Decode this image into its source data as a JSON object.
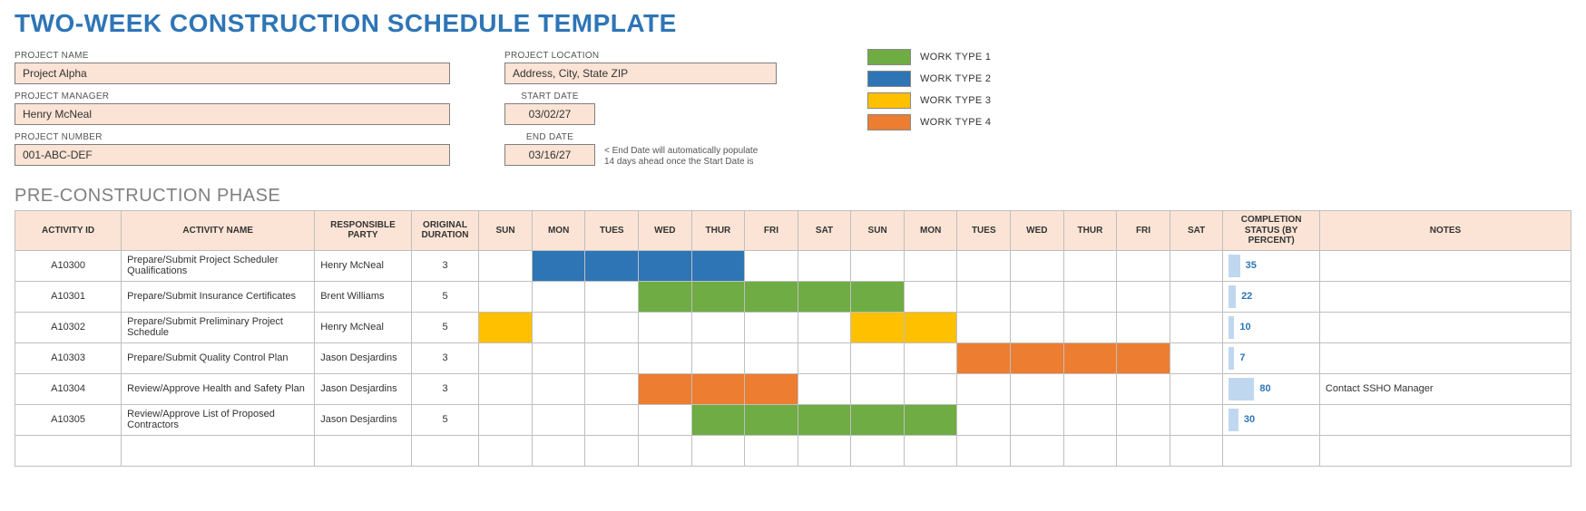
{
  "title": "TWO-WEEK CONSTRUCTION SCHEDULE TEMPLATE",
  "fields": {
    "project_name_label": "PROJECT NAME",
    "project_name": "Project Alpha",
    "project_manager_label": "PROJECT MANAGER",
    "project_manager": "Henry McNeal",
    "project_number_label": "PROJECT NUMBER",
    "project_number": "001-ABC-DEF",
    "project_location_label": "PROJECT LOCATION",
    "project_location": "Address, City, State ZIP",
    "start_date_label": "START DATE",
    "start_date": "03/02/27",
    "end_date_label": "END DATE",
    "end_date": "03/16/27",
    "end_date_note": "< End Date will automatically populate 14 days ahead once the Start Date is"
  },
  "legend": [
    {
      "color": "sw-green",
      "label": "WORK TYPE 1"
    },
    {
      "color": "sw-blue",
      "label": "WORK TYPE 2"
    },
    {
      "color": "sw-yellow",
      "label": "WORK TYPE 3"
    },
    {
      "color": "sw-orange",
      "label": "WORK TYPE 4"
    }
  ],
  "phase_title": "PRE-CONSTRUCTION PHASE",
  "columns": {
    "activity_id": "ACTIVITY ID",
    "activity_name": "ACTIVITY NAME",
    "responsible": "RESPONSIBLE PARTY",
    "duration": "ORIGINAL DURATION",
    "days": [
      "SUN",
      "MON",
      "TUES",
      "WED",
      "THUR",
      "FRI",
      "SAT",
      "SUN",
      "MON",
      "TUES",
      "WED",
      "THUR",
      "FRI",
      "SAT"
    ],
    "completion": "COMPLETION STATUS (BY PERCENT)",
    "notes": "NOTES"
  },
  "colors": {
    "blue": "#2e75b6",
    "green": "#6fac44",
    "yellow": "#ffc000",
    "orange": "#ed7d31"
  },
  "rows": [
    {
      "id": "A10300",
      "name": "Prepare/Submit Project Scheduler Qualifications",
      "resp": "Henry McNeal",
      "dur": "3",
      "bars": [
        {
          "start": 1,
          "end": 4,
          "color": "blue"
        }
      ],
      "completion": 35,
      "notes": ""
    },
    {
      "id": "A10301",
      "name": "Prepare/Submit Insurance Certificates",
      "resp": "Brent Williams",
      "dur": "5",
      "bars": [
        {
          "start": 3,
          "end": 7,
          "color": "green"
        }
      ],
      "completion": 22,
      "notes": ""
    },
    {
      "id": "A10302",
      "name": "Prepare/Submit Preliminary Project Schedule",
      "resp": "Henry McNeal",
      "dur": "5",
      "bars": [
        {
          "start": 0,
          "end": 0,
          "color": "yellow"
        },
        {
          "start": 7,
          "end": 8,
          "color": "yellow"
        }
      ],
      "completion": 10,
      "notes": ""
    },
    {
      "id": "A10303",
      "name": "Prepare/Submit Quality Control Plan",
      "resp": "Jason Desjardins",
      "dur": "3",
      "bars": [
        {
          "start": 9,
          "end": 12,
          "color": "orange"
        }
      ],
      "completion": 7,
      "notes": ""
    },
    {
      "id": "A10304",
      "name": "Review/Approve Health and Safety Plan",
      "resp": "Jason Desjardins",
      "dur": "3",
      "bars": [
        {
          "start": 3,
          "end": 5,
          "color": "orange"
        }
      ],
      "completion": 80,
      "notes": "Contact SSHO Manager"
    },
    {
      "id": "A10305",
      "name": "Review/Approve List of Proposed Contractors",
      "resp": "Jason Desjardins",
      "dur": "5",
      "bars": [
        {
          "start": 4,
          "end": 8,
          "color": "green"
        }
      ],
      "completion": 30,
      "notes": ""
    }
  ]
}
